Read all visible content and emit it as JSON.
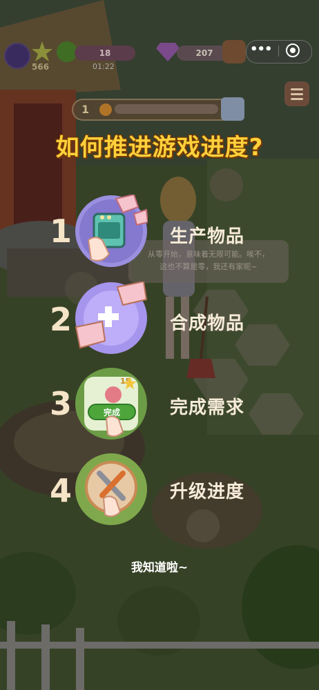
{
  "hud": {
    "star_count": "566",
    "energy": "18",
    "timer": "01:22",
    "gems": "207",
    "more_label": "•••"
  },
  "level": {
    "number": "1",
    "progress": 0.0
  },
  "speech": {
    "line1": "从零开始，意味着无限可能。唉不，",
    "line2": "这也不算是零，我还有家呢~"
  },
  "tutorial": {
    "title": "如何推进游戏进度?",
    "steps": [
      {
        "number": "1",
        "label": "生产物品",
        "icon": "oven-tap-icon"
      },
      {
        "number": "2",
        "label": "合成物品",
        "icon": "merge-cakes-icon"
      },
      {
        "number": "3",
        "label": "完成需求",
        "icon": "complete-order-icon",
        "order_count": "15",
        "button": "完成"
      },
      {
        "number": "4",
        "label": "升级进度",
        "icon": "upgrade-tools-icon"
      }
    ],
    "dismiss": "我知道啦~"
  },
  "colors": {
    "title": "#ffd13b",
    "accent_purple": "#8b7fd8",
    "accent_green": "#4ea63b",
    "text_light": "#f7ecd9"
  }
}
